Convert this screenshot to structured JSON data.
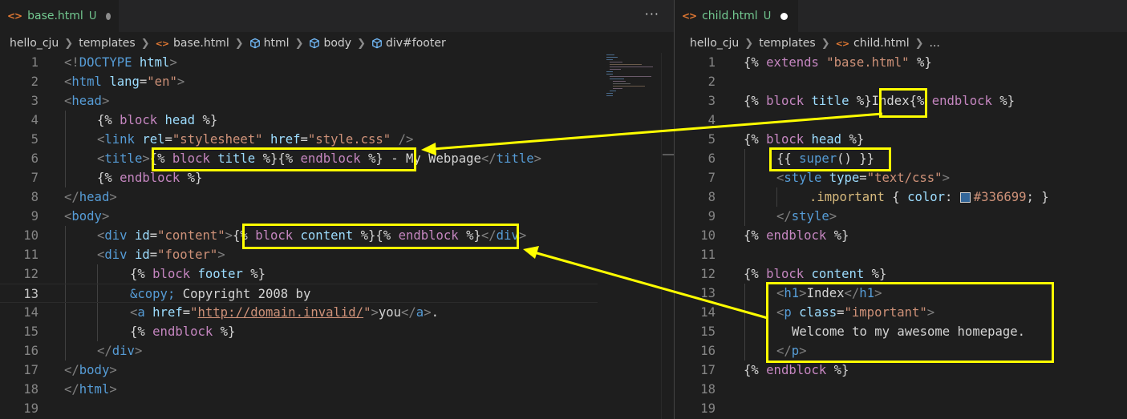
{
  "left": {
    "tab": {
      "icon": "<>",
      "filename": "base.html",
      "git_status": "U"
    },
    "more_actions": "···",
    "breadcrumb": {
      "folder": "hello_cju",
      "subfolder": "templates",
      "file": "base.html",
      "symbols": [
        "html",
        "body",
        "div#footer"
      ]
    },
    "current_line": 13,
    "lines": [
      {
        "n": "1"
      },
      {
        "n": "2"
      },
      {
        "n": "3"
      },
      {
        "n": "4"
      },
      {
        "n": "5"
      },
      {
        "n": "6"
      },
      {
        "n": "7"
      },
      {
        "n": "8"
      },
      {
        "n": "9"
      },
      {
        "n": "10"
      },
      {
        "n": "11"
      },
      {
        "n": "12"
      },
      {
        "n": "13"
      },
      {
        "n": "14"
      },
      {
        "n": "15"
      },
      {
        "n": "16"
      },
      {
        "n": "17"
      },
      {
        "n": "18"
      },
      {
        "n": "19"
      }
    ],
    "tokens": {
      "l1": [
        "<!",
        "DOCTYPE",
        " html",
        ">"
      ],
      "l2": [
        "<",
        "html",
        " lang",
        "=",
        "\"en\"",
        ">"
      ],
      "l3": [
        "<",
        "head",
        ">"
      ],
      "l4": [
        "{% ",
        "block",
        " head",
        " %}"
      ],
      "l5": [
        "<",
        "link",
        " rel",
        "=",
        "\"stylesheet\"",
        " href",
        "=",
        "\"style.css\"",
        " />"
      ],
      "l6": [
        "<",
        "title",
        ">",
        "{% ",
        "block",
        " title",
        " %}",
        "{% ",
        "endblock",
        " %}",
        " - My Webpage",
        "</",
        "title",
        ">"
      ],
      "l7": [
        "{% ",
        "endblock",
        " %}"
      ],
      "l8": [
        "</",
        "head",
        ">"
      ],
      "l9": [
        "<",
        "body",
        ">"
      ],
      "l10": [
        "<",
        "div",
        " id",
        "=",
        "\"content\"",
        ">",
        "{% ",
        "block",
        " content",
        " %}",
        "{% ",
        "endblock",
        " %}",
        "</",
        "div",
        ">"
      ],
      "l11": [
        "<",
        "div",
        " id",
        "=",
        "\"footer\"",
        ">"
      ],
      "l12": [
        "{% ",
        "block",
        " footer",
        " %}"
      ],
      "l13": [
        "&copy;",
        " Copyright 2008 by"
      ],
      "l14": [
        "<",
        "a",
        " href",
        "=",
        "\"",
        "http://domain.invalid/",
        "\"",
        ">",
        "you",
        "</",
        "a",
        ">",
        "."
      ],
      "l15": [
        "{% ",
        "endblock",
        " %}"
      ],
      "l16": [
        "</",
        "div",
        ">"
      ],
      "l17": [
        "</",
        "body",
        ">"
      ],
      "l18": [
        "</",
        "html",
        ">"
      ]
    }
  },
  "right": {
    "tab": {
      "icon": "<>",
      "filename": "child.html",
      "git_status": "U"
    },
    "breadcrumb": {
      "folder": "hello_cju",
      "subfolder": "templates",
      "file": "child.html",
      "ellipsis": "..."
    },
    "lines": [
      {
        "n": "1"
      },
      {
        "n": "2"
      },
      {
        "n": "3"
      },
      {
        "n": "4"
      },
      {
        "n": "5"
      },
      {
        "n": "6"
      },
      {
        "n": "7"
      },
      {
        "n": "8"
      },
      {
        "n": "9"
      },
      {
        "n": "10"
      },
      {
        "n": "11"
      },
      {
        "n": "12"
      },
      {
        "n": "13"
      },
      {
        "n": "14"
      },
      {
        "n": "15"
      },
      {
        "n": "16"
      },
      {
        "n": "17"
      },
      {
        "n": "18"
      },
      {
        "n": "19"
      }
    ],
    "tokens": {
      "l1": [
        "{% ",
        "extends",
        " \"base.html\"",
        " %}"
      ],
      "l3": [
        "{% ",
        "block",
        " title",
        " %}",
        "Index",
        "{% ",
        "endblock",
        " %}"
      ],
      "l5": [
        "{% ",
        "block",
        " head",
        " %}"
      ],
      "l6": [
        "{{ ",
        "super",
        "()",
        " }}"
      ],
      "l7": [
        "<",
        "style",
        " type",
        "=",
        "\"text/css\"",
        ">"
      ],
      "l8": [
        ".important",
        " { ",
        "color",
        ": ",
        "#336699",
        "; }"
      ],
      "l9": [
        "</",
        "style",
        ">"
      ],
      "l10": [
        "{% ",
        "endblock",
        " %}"
      ],
      "l12": [
        "{% ",
        "block",
        " content",
        " %}"
      ],
      "l13": [
        "<",
        "h1",
        ">",
        "Index",
        "</",
        "h1",
        ">"
      ],
      "l14": [
        "<",
        "p",
        " class",
        "=",
        "\"important\"",
        ">"
      ],
      "l15": [
        "Welcome to my awesome homepage."
      ],
      "l16": [
        "</",
        "p",
        ">"
      ],
      "l17": [
        "{% ",
        "endblock",
        " %}"
      ]
    }
  },
  "colors": {
    "highlight": "#ffff00",
    "swatch": "#336699",
    "editor_bg": "#1e1e1e",
    "tag": "#569cd6",
    "attr": "#9cdcfe",
    "string": "#ce9178",
    "keyword": "#c586c0"
  },
  "icons": {
    "tab": "html-file-icon",
    "breadcrumb_symbol": "symbol-cube-icon",
    "more": "more-actions-icon"
  }
}
